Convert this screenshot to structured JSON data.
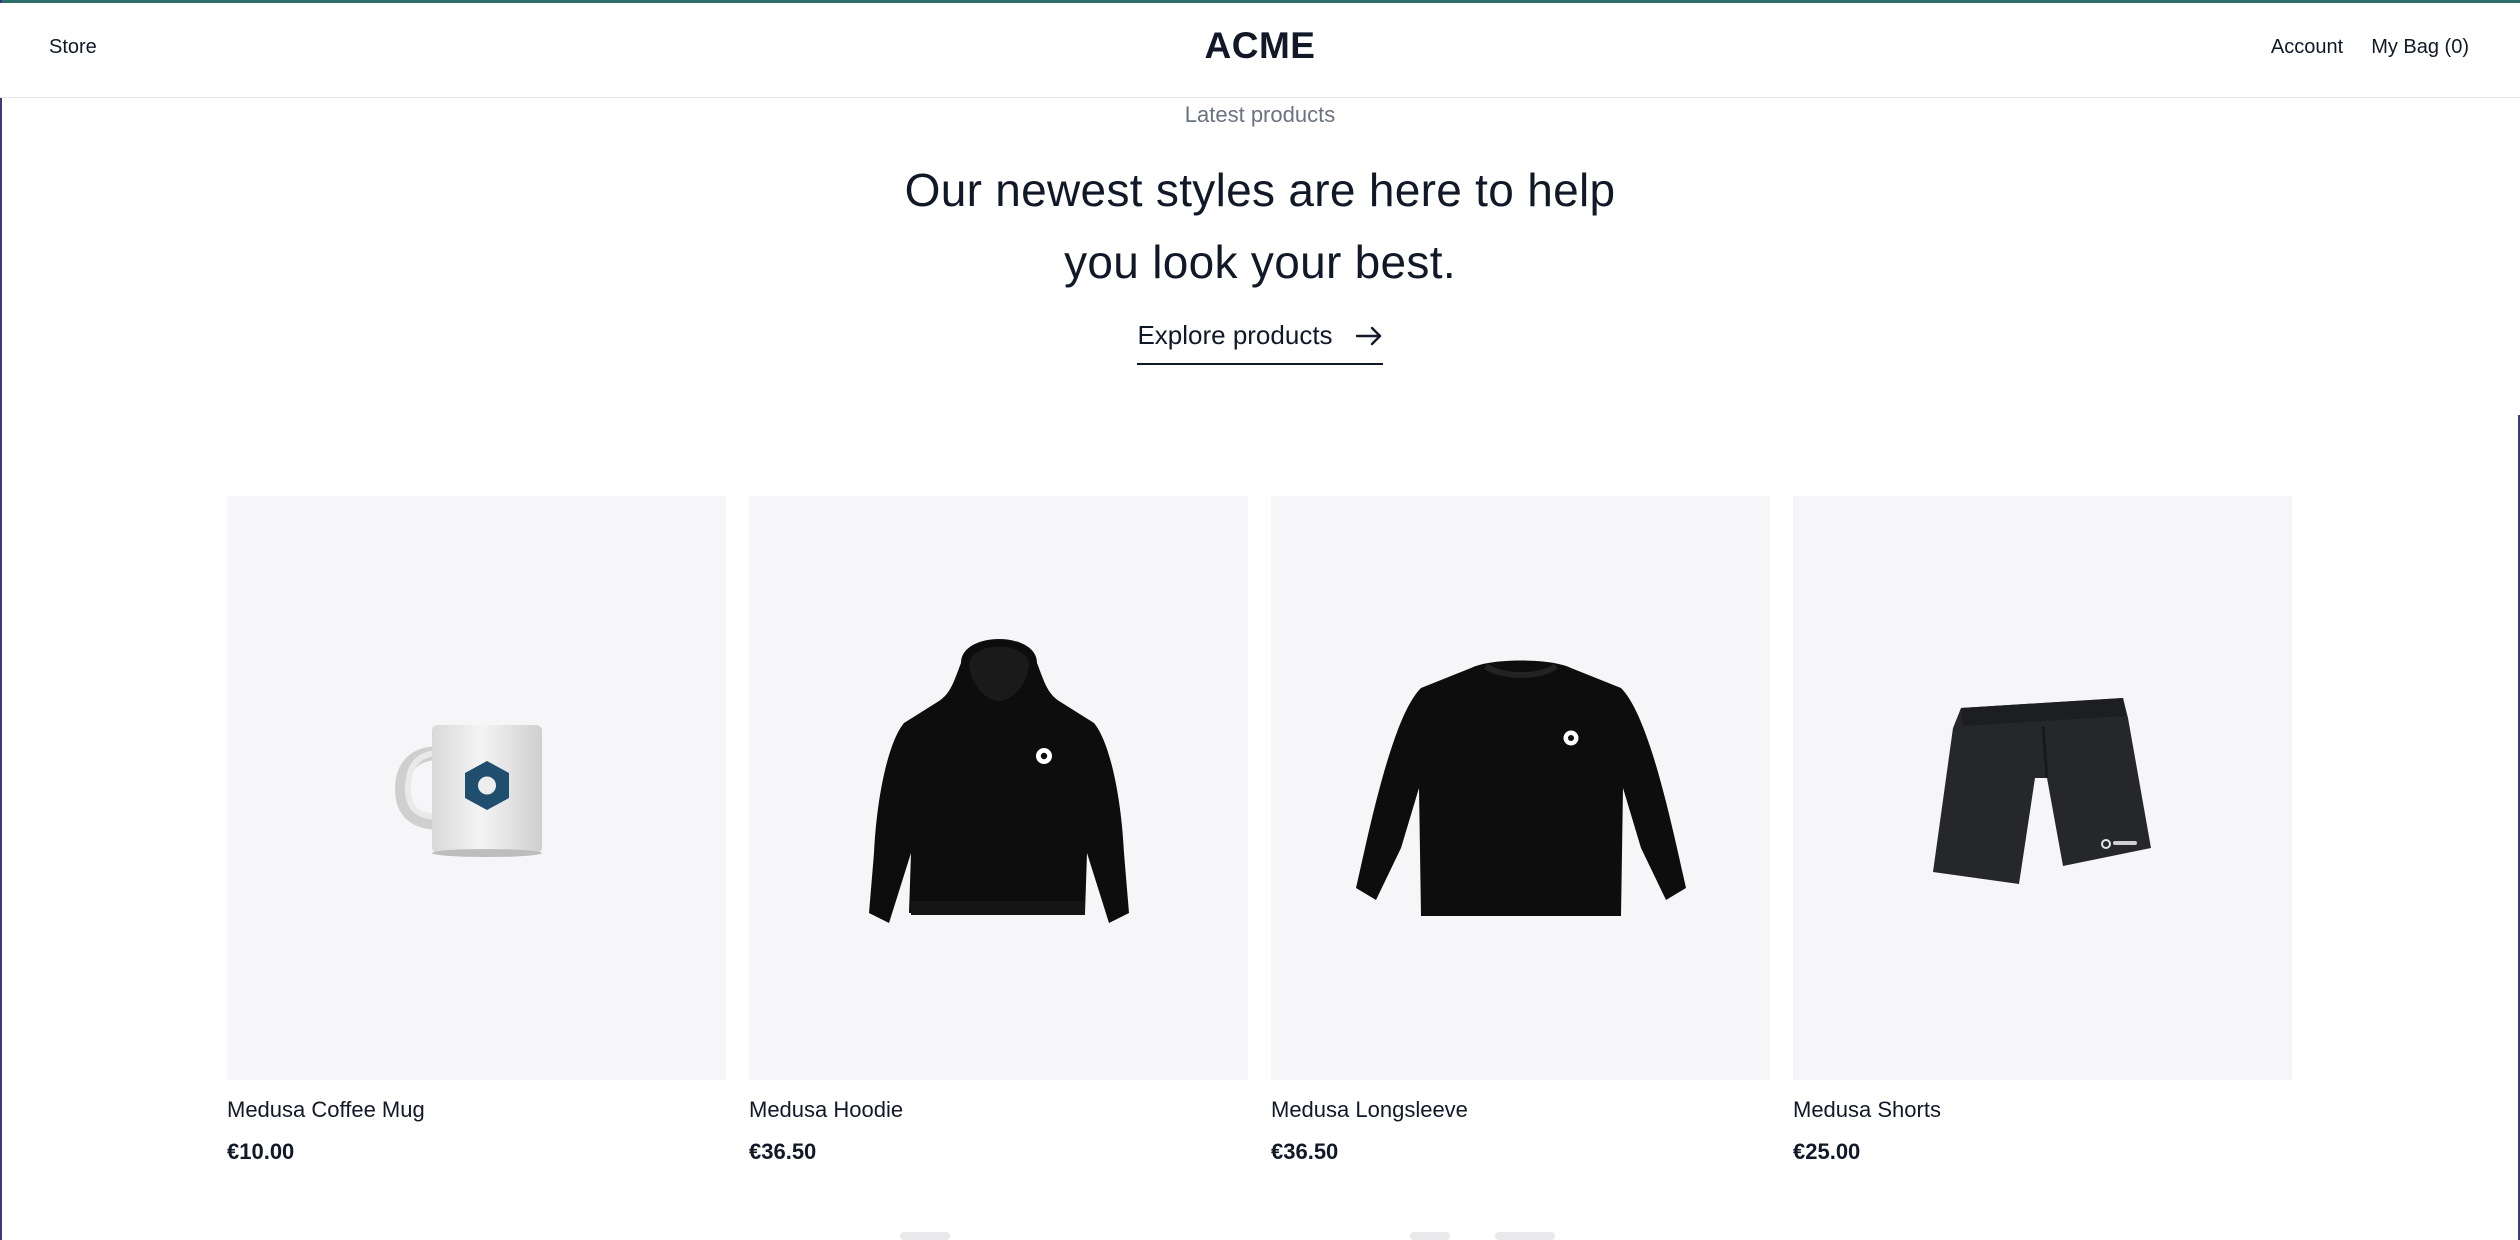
{
  "nav": {
    "store": "Store",
    "logo": "ACME",
    "account": "Account",
    "bag": "My Bag (0)"
  },
  "hero": {
    "eyebrow": "Latest products",
    "headline_line1": "Our newest styles are here to help",
    "headline_line2": "you look your best.",
    "cta": "Explore products"
  },
  "products": [
    {
      "name": "Medusa Coffee Mug",
      "price": "€10.00",
      "image": "coffee-mug"
    },
    {
      "name": "Medusa Hoodie",
      "price": "€36.50",
      "image": "hoodie"
    },
    {
      "name": "Medusa Longsleeve",
      "price": "€36.50",
      "image": "longsleeve"
    },
    {
      "name": "Medusa Shorts",
      "price": "€25.00",
      "image": "shorts"
    }
  ],
  "colors": {
    "text": "#111827",
    "muted": "#6b7280",
    "card_bg": "#f6f6f8",
    "logo_blue": "#1f4e6e"
  }
}
